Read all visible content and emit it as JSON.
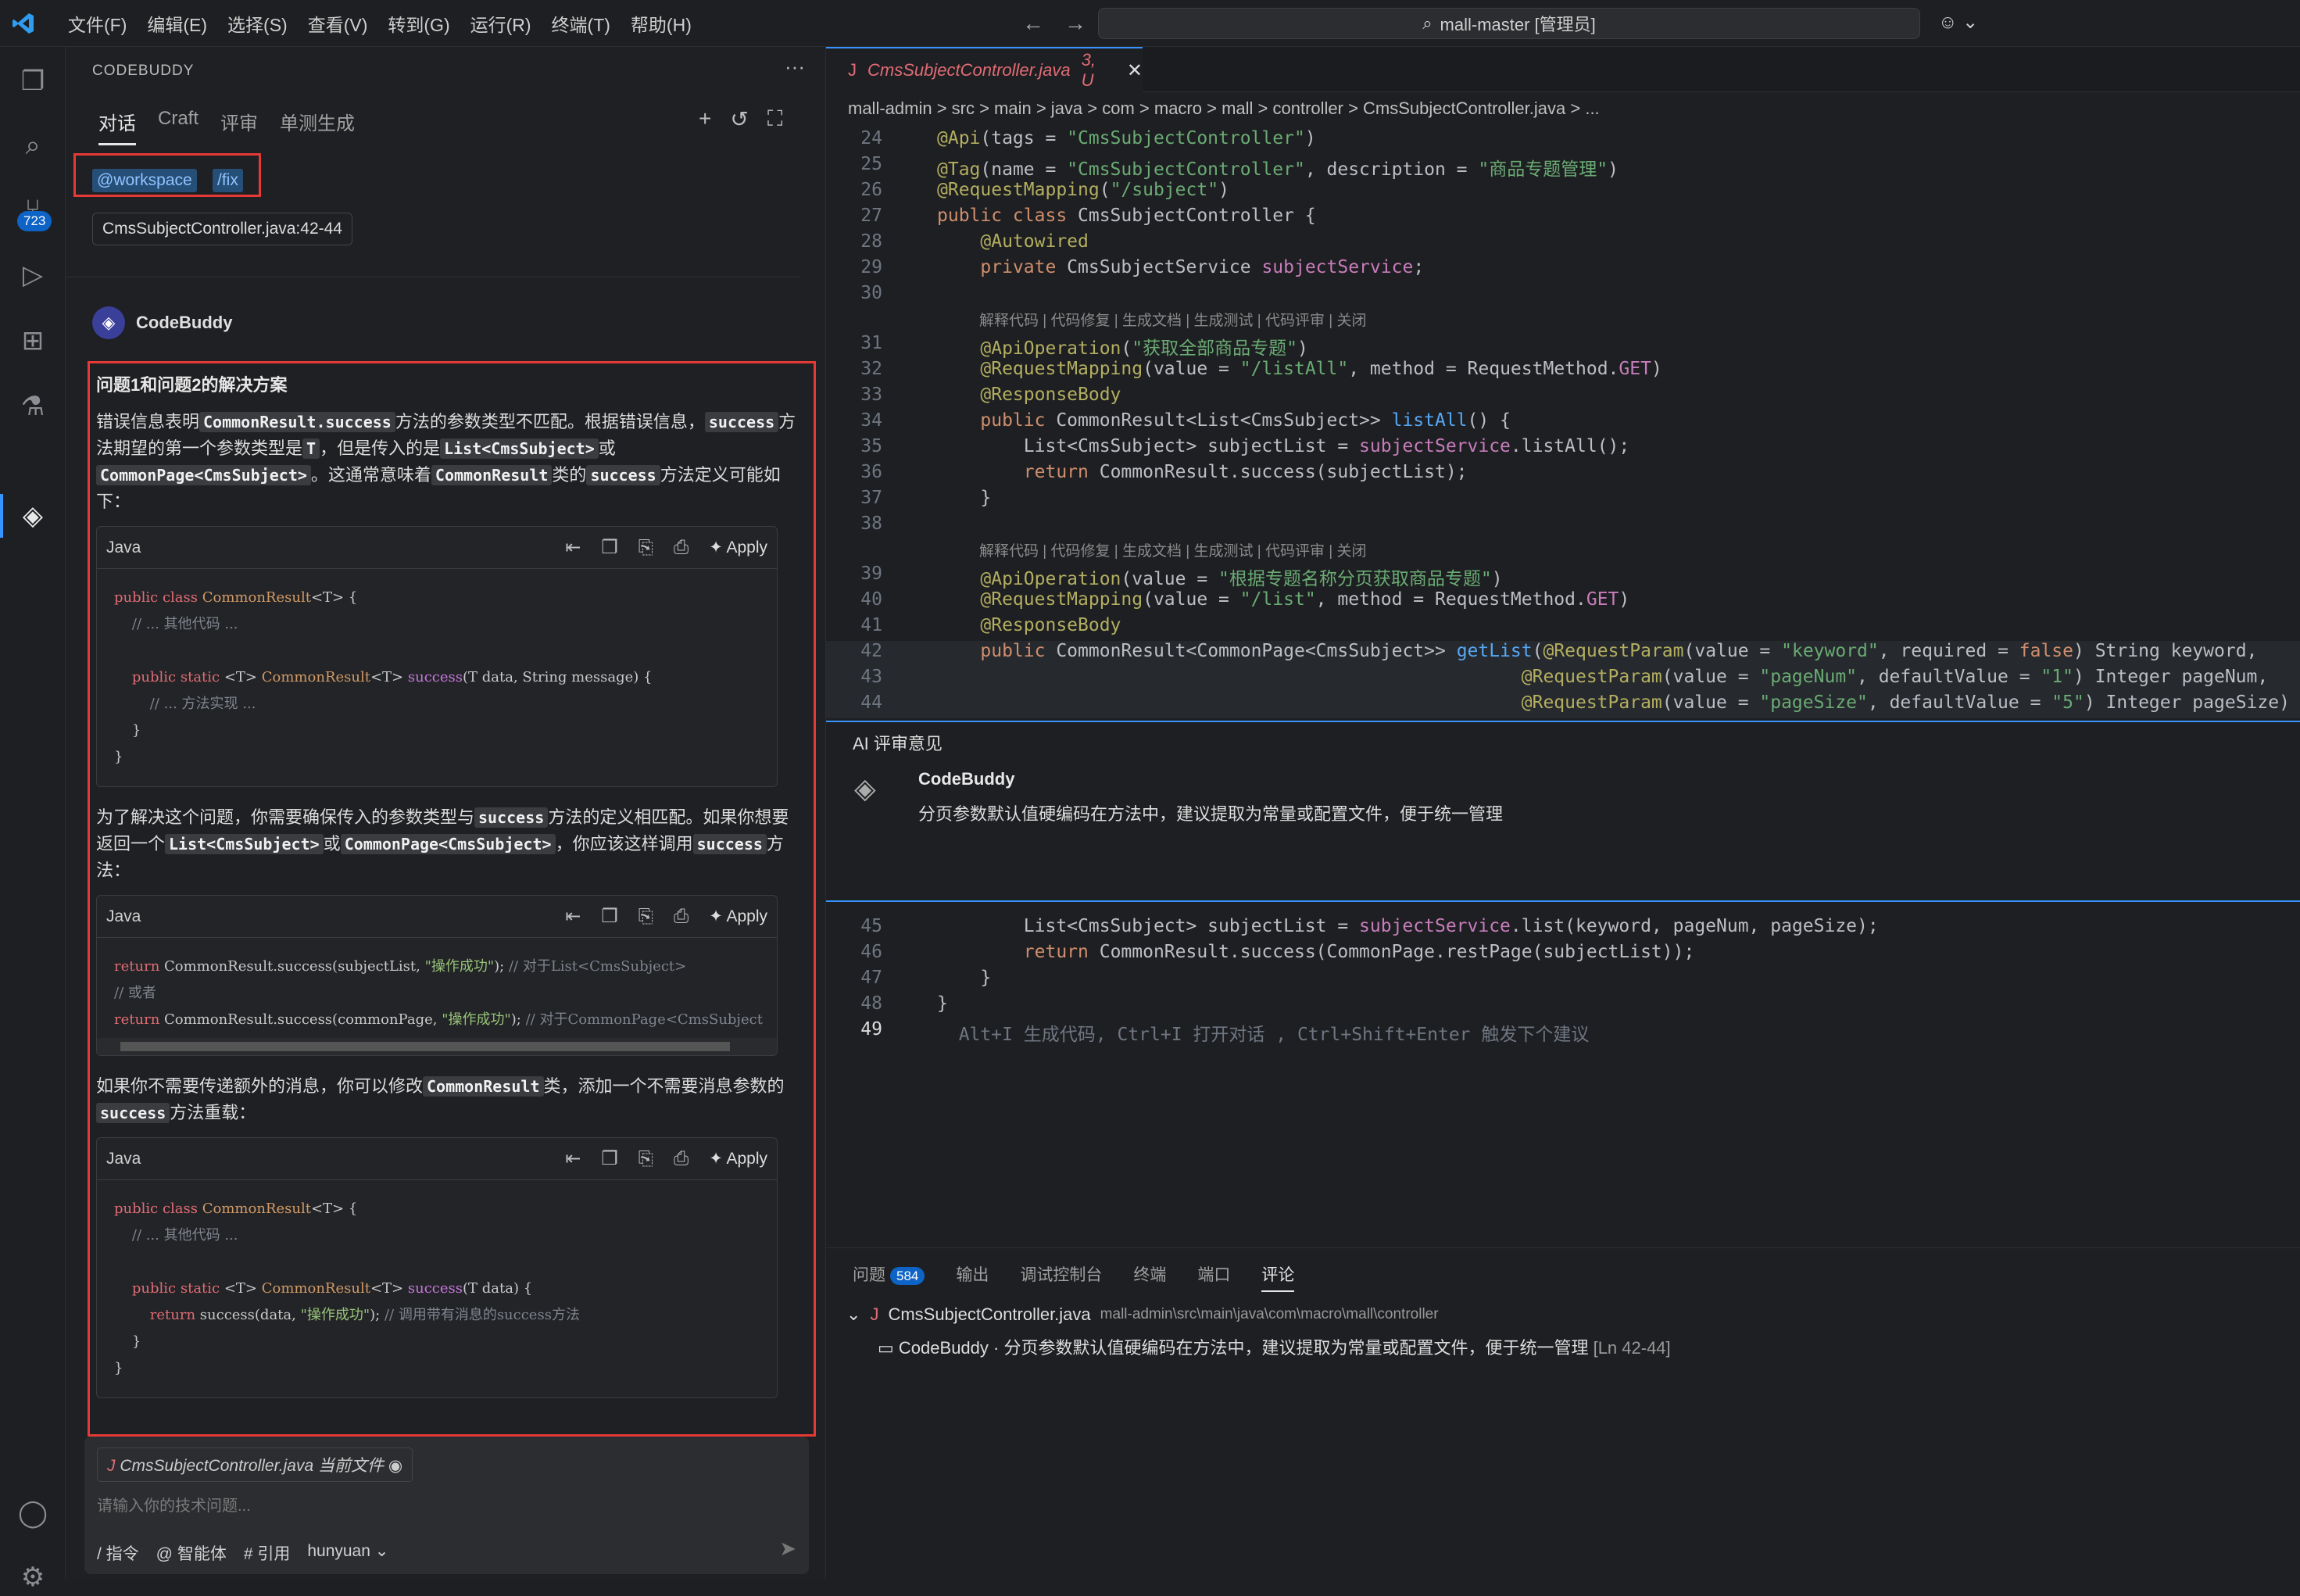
{
  "menu": [
    "文件(F)",
    "编辑(E)",
    "选择(S)",
    "查看(V)",
    "转到(G)",
    "运行(R)",
    "终端(T)",
    "帮助(H)"
  ],
  "command_center": "mall-master [管理员]",
  "activity_badge": "723",
  "sidebar": {
    "title": "CODEBUDDY",
    "tabs": [
      "对话",
      "Craft",
      "评审",
      "单测生成"
    ],
    "chips": [
      "@workspace",
      "/fix"
    ],
    "file_ref": "CmsSubjectController.java:42-44",
    "assistant_name": "CodeBuddy",
    "answer": {
      "heading": "问题1和问题2的解决方案",
      "p1_a": "错误信息表明",
      "p1_c1": "CommonResult.success",
      "p1_b": "方法的参数类型不匹配。根据错误信息，",
      "p1_c2": "success",
      "p1_d": "方法期望的第一个参数类型是",
      "p1_c3": "T",
      "p1_e": "，但是传入的是",
      "p1_c4": "List<CmsSubject>",
      "p1_f": "或",
      "p1_c5": "CommonPage<CmsSubject>",
      "p1_g": "。这通常意味着",
      "p1_c6": "CommonResult",
      "p1_h": "类的",
      "p1_c7": "success",
      "p1_i": "方法定义可能如下：",
      "p2_a": "为了解决这个问题，你需要确保传入的参数类型与",
      "p2_c1": "success",
      "p2_b": "方法的定义相匹配。如果你想要返回一个",
      "p2_c2": "List<CmsSubject>",
      "p2_d": "或",
      "p2_c3": "CommonPage<CmsSubject>",
      "p2_e": "，你应该这样调用",
      "p2_c4": "success",
      "p2_f": "方法：",
      "p3_a": "如果你不需要传递额外的消息，你可以修改",
      "p3_c1": "CommonResult",
      "p3_b": "类，添加一个不需要消息参数的",
      "p3_c2": "success",
      "p3_c": "方法重载：",
      "code_lang": "Java",
      "apply": "Apply"
    },
    "input": {
      "current_file": "CmsSubjectController.java",
      "current_file_tag": "当前文件",
      "placeholder": "请输入你的技术问题...",
      "tools": [
        "/ 指令",
        "@ 智能体",
        "# 引用",
        "hunyuan"
      ]
    }
  },
  "editor": {
    "tab_name": "CmsSubjectController.java",
    "tab_status": "3, U",
    "breadcrumb": "mall-admin > src > main > java > com > macro > mall > controller > CmsSubjectController.java > ...",
    "codelens": "解释代码 | 代码修复 | 生成文档 | 生成测试 | 代码评审 | 关闭",
    "ghost_hint": "Alt+I 生成代码, Ctrl+I 打开对话 , Ctrl+Shift+Enter 触发下个建议",
    "review": {
      "title": "AI 评审意见",
      "author": "CodeBuddy",
      "comment": "分页参数默认值硬编码在方法中，建议提取为常量或配置文件，便于统一管理"
    }
  },
  "panel": {
    "tabs": [
      "问题",
      "输出",
      "调试控制台",
      "终端",
      "端口",
      "评论"
    ],
    "problems_count": "584",
    "file": "CmsSubjectController.java",
    "path": "mall-admin\\src\\main\\java\\com\\macro\\mall\\controller",
    "entry": "CodeBuddy · 分页参数默认值硬编码在方法中，建议提取为常量或配置文件，便于统一管理",
    "entry_lines": "[Ln 42-44]"
  }
}
